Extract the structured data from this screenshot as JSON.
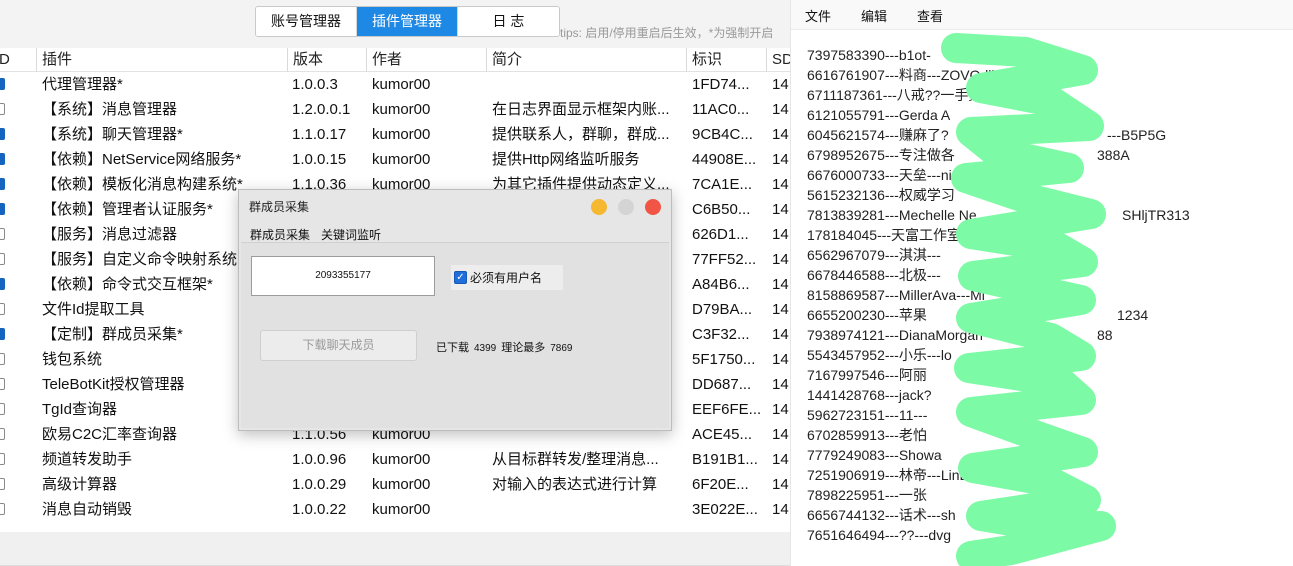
{
  "left_window": {
    "tabs": [
      {
        "label": "账号管理器",
        "active": false
      },
      {
        "label": "插件管理器",
        "active": true
      },
      {
        "label": "日 志",
        "active": false
      }
    ],
    "hint": "tips: 启用/停用重启后生效，*为强制开启",
    "columns": [
      "D",
      "插件",
      "版本",
      "作者",
      "简介",
      "标识",
      "SD"
    ],
    "rows": [
      {
        "enabled": true,
        "name": "代理管理器*",
        "version": "1.0.0.3",
        "author": "kumor00",
        "desc": "",
        "id": "1FD74...",
        "sd": "14"
      },
      {
        "enabled": false,
        "name": "【系统】消息管理器",
        "version": "1.2.0.0.1",
        "author": "kumor00",
        "desc": "在日志界面显示框架内账...",
        "id": "11AC0...",
        "sd": "14"
      },
      {
        "enabled": true,
        "name": "【系统】聊天管理器*",
        "version": "1.1.0.17",
        "author": "kumor00",
        "desc": "提供联系人，群聊，群成...",
        "id": "9CB4C...",
        "sd": "14"
      },
      {
        "enabled": true,
        "name": "【依赖】NetService网络服务*",
        "version": "1.0.0.15",
        "author": "kumor00",
        "desc": "提供Http网络监听服务",
        "id": "44908E...",
        "sd": "14"
      },
      {
        "enabled": true,
        "name": "【依赖】模板化消息构建系统*",
        "version": "1.1.0.36",
        "author": "kumor00",
        "desc": "为其它插件提供动态定义...",
        "id": "7CA1E...",
        "sd": "14"
      },
      {
        "enabled": true,
        "name": "【依赖】管理者认证服务*",
        "version": "",
        "author": "",
        "desc": "",
        "id": "C6B50...",
        "sd": "14"
      },
      {
        "enabled": false,
        "name": "【服务】消息过滤器",
        "version": "",
        "author": "",
        "desc": "",
        "id": "626D1...",
        "sd": "14"
      },
      {
        "enabled": false,
        "name": "【服务】自定义命令映射系统",
        "version": "",
        "author": "",
        "desc": "",
        "id": "77FF52...",
        "sd": "14"
      },
      {
        "enabled": true,
        "name": "【依赖】命令式交互框架*",
        "version": "",
        "author": "",
        "desc": "",
        "id": "A84B6...",
        "sd": "14"
      },
      {
        "enabled": false,
        "name": "文件Id提取工具",
        "version": "",
        "author": "",
        "desc": "",
        "id": "D79BA...",
        "sd": "14"
      },
      {
        "enabled": true,
        "name": "【定制】群成员采集*",
        "version": "",
        "author": "",
        "desc": "",
        "id": "C3F32...",
        "sd": "14"
      },
      {
        "enabled": false,
        "name": "钱包系统",
        "version": "",
        "author": "",
        "desc": "",
        "id": "5F1750...",
        "sd": "14"
      },
      {
        "enabled": false,
        "name": "TeleBotKit授权管理器",
        "version": "",
        "author": "",
        "desc": "",
        "id": "DD687...",
        "sd": "14"
      },
      {
        "enabled": false,
        "name": "TgId查询器",
        "version": "",
        "author": "",
        "desc": "",
        "id": "EEF6FE...",
        "sd": "14"
      },
      {
        "enabled": false,
        "name": "欧易C2C汇率查询器",
        "version": "1.1.0.56",
        "author": "kumor00",
        "desc": "",
        "id": "ACE45...",
        "sd": "14"
      },
      {
        "enabled": false,
        "name": "频道转发助手",
        "version": "1.0.0.96",
        "author": "kumor00",
        "desc": "从目标群转发/整理消息...",
        "id": "B191B1...",
        "sd": "14"
      },
      {
        "enabled": false,
        "name": "高级计算器",
        "version": "1.0.0.29",
        "author": "kumor00",
        "desc": "对输入的表达式进行计算",
        "id": "6F20E...",
        "sd": "14"
      },
      {
        "enabled": false,
        "name": "消息自动销毁",
        "version": "1.0.0.22",
        "author": "kumor00",
        "desc": "",
        "id": "3E022E...",
        "sd": "14"
      }
    ]
  },
  "dialog": {
    "title": "群成员采集",
    "menu": [
      "群成员采集",
      "关键词监听"
    ],
    "group_id": "2093355177",
    "checkbox_label": "必须有用户名",
    "checkbox_checked": true,
    "download_button": "下载聊天成员",
    "downloaded_label": "已下载",
    "downloaded_count": "4399",
    "max_label": "理论最多",
    "max_count": "7869",
    "colors": {
      "close": "#f05545",
      "minimize": "#f5b82e",
      "maximize": "#d4d4d4"
    }
  },
  "editor": {
    "menu": [
      "文件",
      "编辑",
      "查看"
    ],
    "lines": [
      "7397583390---b1ot-",
      "6616761907---料商---ZOVQdliBni",
      "6711187361---八戒??一手数据---baij",
      "6121055791---Gerda A",
      "6045621574---赚麻了?",
      "6798952675---专注做各",
      "6676000733---天垒---ning77",
      "5615232136---权威学习",
      "7813839281---Mechelle Ne",
      "178184045---天富工作室",
      "6562967079---淇淇---",
      "6678446588---北极---",
      "8158869587---MillerAva---Mi",
      "6655200230---苹果",
      "7938974121---DianaMorgan",
      "5543457952---小乐---lo",
      "7167997546---阿丽",
      "1441428768---jack?",
      "5962723151---11---",
      "6702859913---老怕",
      "7779249083---Showa",
      "7251906919---林帝---LinDi",
      "7898225951---一张",
      "6656744132---话术---sh",
      "7651646494---??---dvg"
    ],
    "line_tails": [
      {
        "line": 0,
        "text": "d",
        "offset": 244
      },
      {
        "line": 4,
        "text": "---B5P5G",
        "offset": 300
      },
      {
        "line": 5,
        "text": "388A",
        "offset": 290
      },
      {
        "line": 8,
        "text": "SHljTR313",
        "offset": 315
      },
      {
        "line": 13,
        "text": "1234",
        "offset": 310
      },
      {
        "line": 14,
        "text": "88",
        "offset": 290
      }
    ],
    "redaction_color": "#7dfaa6"
  }
}
